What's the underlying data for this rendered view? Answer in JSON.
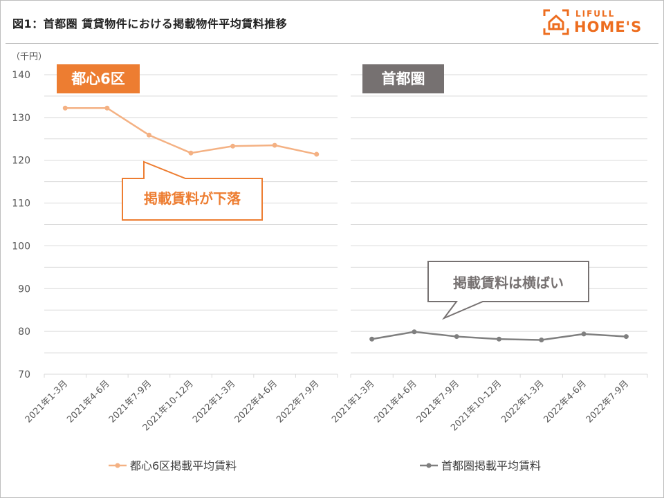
{
  "title": "図1：首都圏 賃貸物件における掲載物件平均賃料推移",
  "logo": {
    "top": "LIFULL",
    "bottom": "HOME'S"
  },
  "colors": {
    "orange": "#ed7d31",
    "orange_line": "#f4b183",
    "gray": "#767171",
    "gray_line": "#7f7f7f"
  },
  "chart_data": {
    "type": "line",
    "y_unit": "（千円）",
    "ylim": [
      70,
      140
    ],
    "yticks": [
      70,
      80,
      90,
      100,
      110,
      120,
      130,
      140
    ],
    "grid": true,
    "categories": [
      "2021年1-3月",
      "2021年4-6月",
      "2021年7-9月",
      "2021年10-12月",
      "2022年1-3月",
      "2022年4-6月",
      "2022年7-9月"
    ],
    "panels": [
      {
        "label": "都心6区",
        "callout": "掲載賃料が下落",
        "series": [
          {
            "name": "都心6区掲載平均賃料",
            "values": [
              132.2,
              132.2,
              125.9,
              121.7,
              123.3,
              123.5,
              121.4
            ]
          }
        ]
      },
      {
        "label": "首都圏",
        "callout": "掲載賃料は横ばい",
        "series": [
          {
            "name": "首都圏掲載平均賃料",
            "values": [
              78.2,
              79.9,
              78.8,
              78.2,
              78.0,
              79.4,
              78.8
            ]
          }
        ]
      }
    ],
    "legend": "bottom"
  }
}
